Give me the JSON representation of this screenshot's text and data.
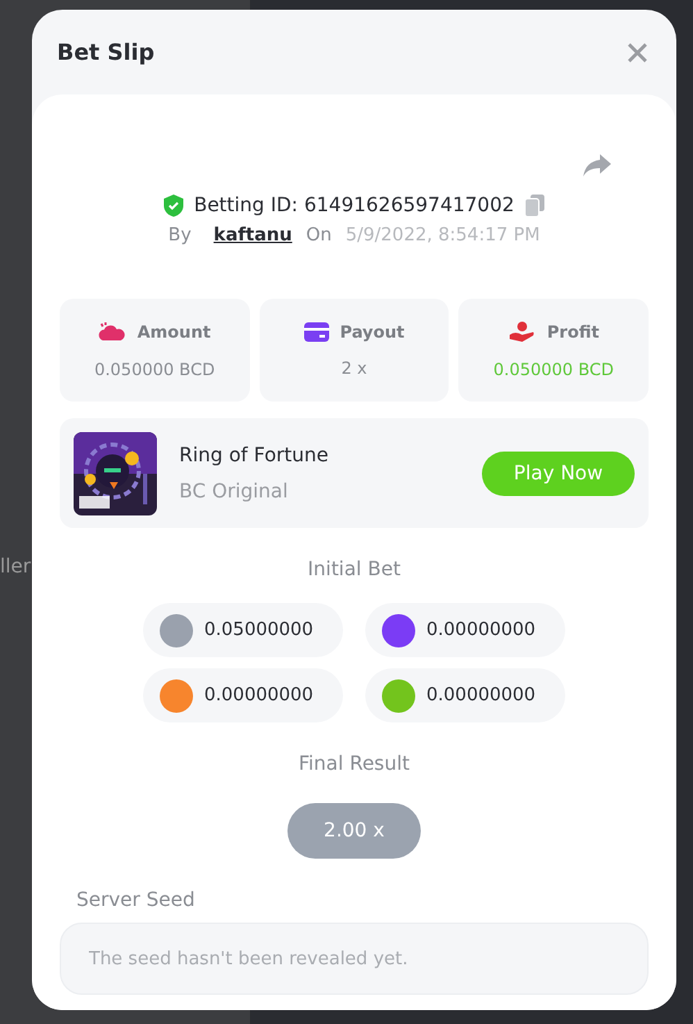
{
  "background": {
    "fragment": "ller"
  },
  "modal": {
    "title": "Bet Slip"
  },
  "bet": {
    "id_label": "Betting ID: 61491626597417002",
    "by_label": "By",
    "user": "kaftanu",
    "on_label": "On",
    "date": "5/9/2022, 8:54:17 PM"
  },
  "stats": [
    {
      "kind": "amount",
      "label": "Amount",
      "value": "0.050000 BCD",
      "color": "#8a8d93"
    },
    {
      "kind": "payout",
      "label": "Payout",
      "value": "2 x",
      "color": "#8a8d93"
    },
    {
      "kind": "profit",
      "label": "Profit",
      "value": "0.050000 BCD",
      "color": "#5fc83a"
    }
  ],
  "game": {
    "title": "Ring of Fortune",
    "subtitle": "BC Original",
    "button": "Play Now"
  },
  "initial_bet": {
    "title": "Initial Bet",
    "chips": [
      {
        "color": "#9aa1ad",
        "amount": "0.05000000"
      },
      {
        "color": "#7b3cf5",
        "amount": "0.00000000"
      },
      {
        "color": "#f7852d",
        "amount": "0.00000000"
      },
      {
        "color": "#73c41d",
        "amount": "0.00000000"
      }
    ]
  },
  "final_result": {
    "title": "Final Result",
    "value": "2.00 x"
  },
  "server_seed": {
    "label": "Server Seed",
    "placeholder": "The seed hasn't been revealed yet."
  }
}
